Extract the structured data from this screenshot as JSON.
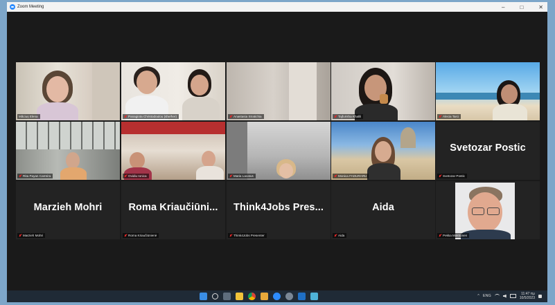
{
  "window": {
    "title": "Zoom Meeting",
    "controls": [
      "–",
      "□",
      "✕"
    ]
  },
  "participants": [
    {
      "name": "Măciuș Elena",
      "type": "video",
      "active": true
    },
    {
      "name": "Panagiota Christodoulou (she/her)",
      "type": "video"
    },
    {
      "name": "Anastasia Stratichia",
      "type": "video"
    },
    {
      "name": "Tajfurisha Khalili",
      "type": "video"
    },
    {
      "name": "Alecia Tarci",
      "type": "video"
    },
    {
      "name": "Rita Payan Carreira",
      "type": "video"
    },
    {
      "name": "Ovidiu Ionica",
      "type": "video"
    },
    {
      "name": "Maria Lacatus",
      "type": "video"
    },
    {
      "name": "Monica FADURARU",
      "type": "video"
    },
    {
      "name": "Svetozar Postic",
      "type": "name",
      "display": "Svetozar Postic"
    },
    {
      "name": "Marzieh Mohri",
      "type": "name",
      "display": "Marzieh Mohri"
    },
    {
      "name": "Roma Kriaučiūnienė",
      "type": "name",
      "display": "Roma  Kriaučiūni..."
    },
    {
      "name": "Think4Jobs Presenter",
      "type": "name",
      "display": "Think4Jobs  Pres..."
    },
    {
      "name": "Aida",
      "type": "name",
      "display": "Aida"
    },
    {
      "name": "Pekka Makkonen",
      "type": "photo"
    }
  ],
  "taskbar": {
    "icons": [
      "windows-start-icon",
      "search-icon",
      "task-view-icon",
      "file-explorer-icon",
      "chrome-icon",
      "folder-icon",
      "zoom-icon",
      "settings-icon",
      "outlook-icon",
      "notepad-icon"
    ],
    "tray": {
      "chevron": "^",
      "language": "ENG",
      "time": "11:47 πμ",
      "date": "10/5/2023"
    }
  },
  "colors": {
    "active_border": "#d9e046",
    "mute_red": "#e02828",
    "zoom_blue": "#2d8cff"
  }
}
